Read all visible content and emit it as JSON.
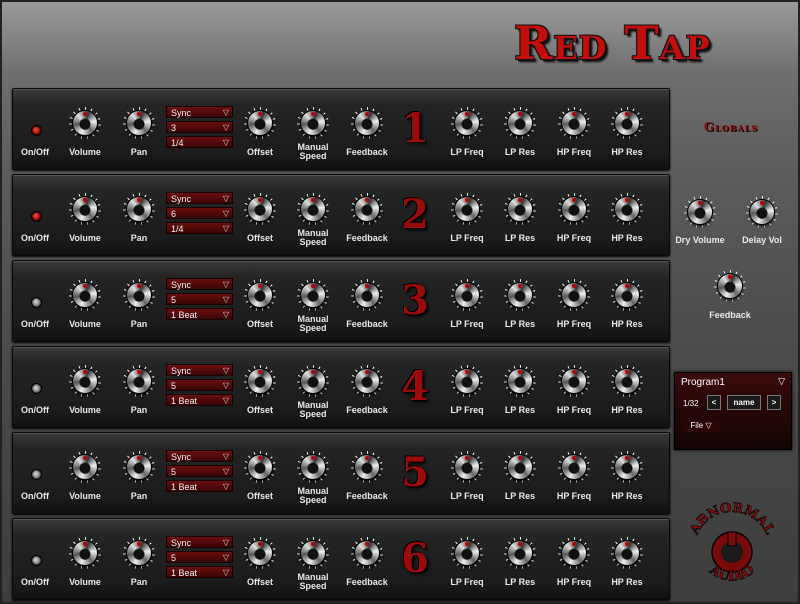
{
  "app": {
    "title": "Red Tap",
    "globals_title": "Globals"
  },
  "labels": {
    "on_off": "On/Off",
    "volume": "Volume",
    "pan": "Pan",
    "offset": "Offset",
    "manual_speed": "Manual Speed",
    "feedback": "Feedback",
    "lp_freq": "LP Freq",
    "lp_res": "LP Res",
    "hp_freq": "HP Freq",
    "hp_res": "HP Res"
  },
  "taps": [
    {
      "number": "1",
      "on": true,
      "mode": "Sync",
      "value": "3",
      "division": "1/4"
    },
    {
      "number": "2",
      "on": true,
      "mode": "Sync",
      "value": "6",
      "division": "1/4"
    },
    {
      "number": "3",
      "on": false,
      "mode": "Sync",
      "value": "5",
      "division": "1 Beat"
    },
    {
      "number": "4",
      "on": false,
      "mode": "Sync",
      "value": "5",
      "division": "1 Beat"
    },
    {
      "number": "5",
      "on": false,
      "mode": "Sync",
      "value": "5",
      "division": "1 Beat"
    },
    {
      "number": "6",
      "on": false,
      "mode": "Sync",
      "value": "5",
      "division": "1 Beat"
    }
  ],
  "globals": {
    "dry_volume": "Dry Volume",
    "delay_vol": "Delay Vol",
    "feedback": "Feedback"
  },
  "program": {
    "name": "Program1",
    "dropdown_glyph": "▽",
    "count": "1/32",
    "prev": "<",
    "rename": "name",
    "next": ">",
    "file": "File ▽"
  },
  "icons": {
    "select_arrow": "▽"
  },
  "logo": {
    "top_text": "ABNORMAL",
    "bottom_text": "AUDIO"
  },
  "colors": {
    "accent": "#c40d0d",
    "panel": "#1b1b1b",
    "led_on": "#d81c12",
    "led_off": "#cfcfcf"
  }
}
